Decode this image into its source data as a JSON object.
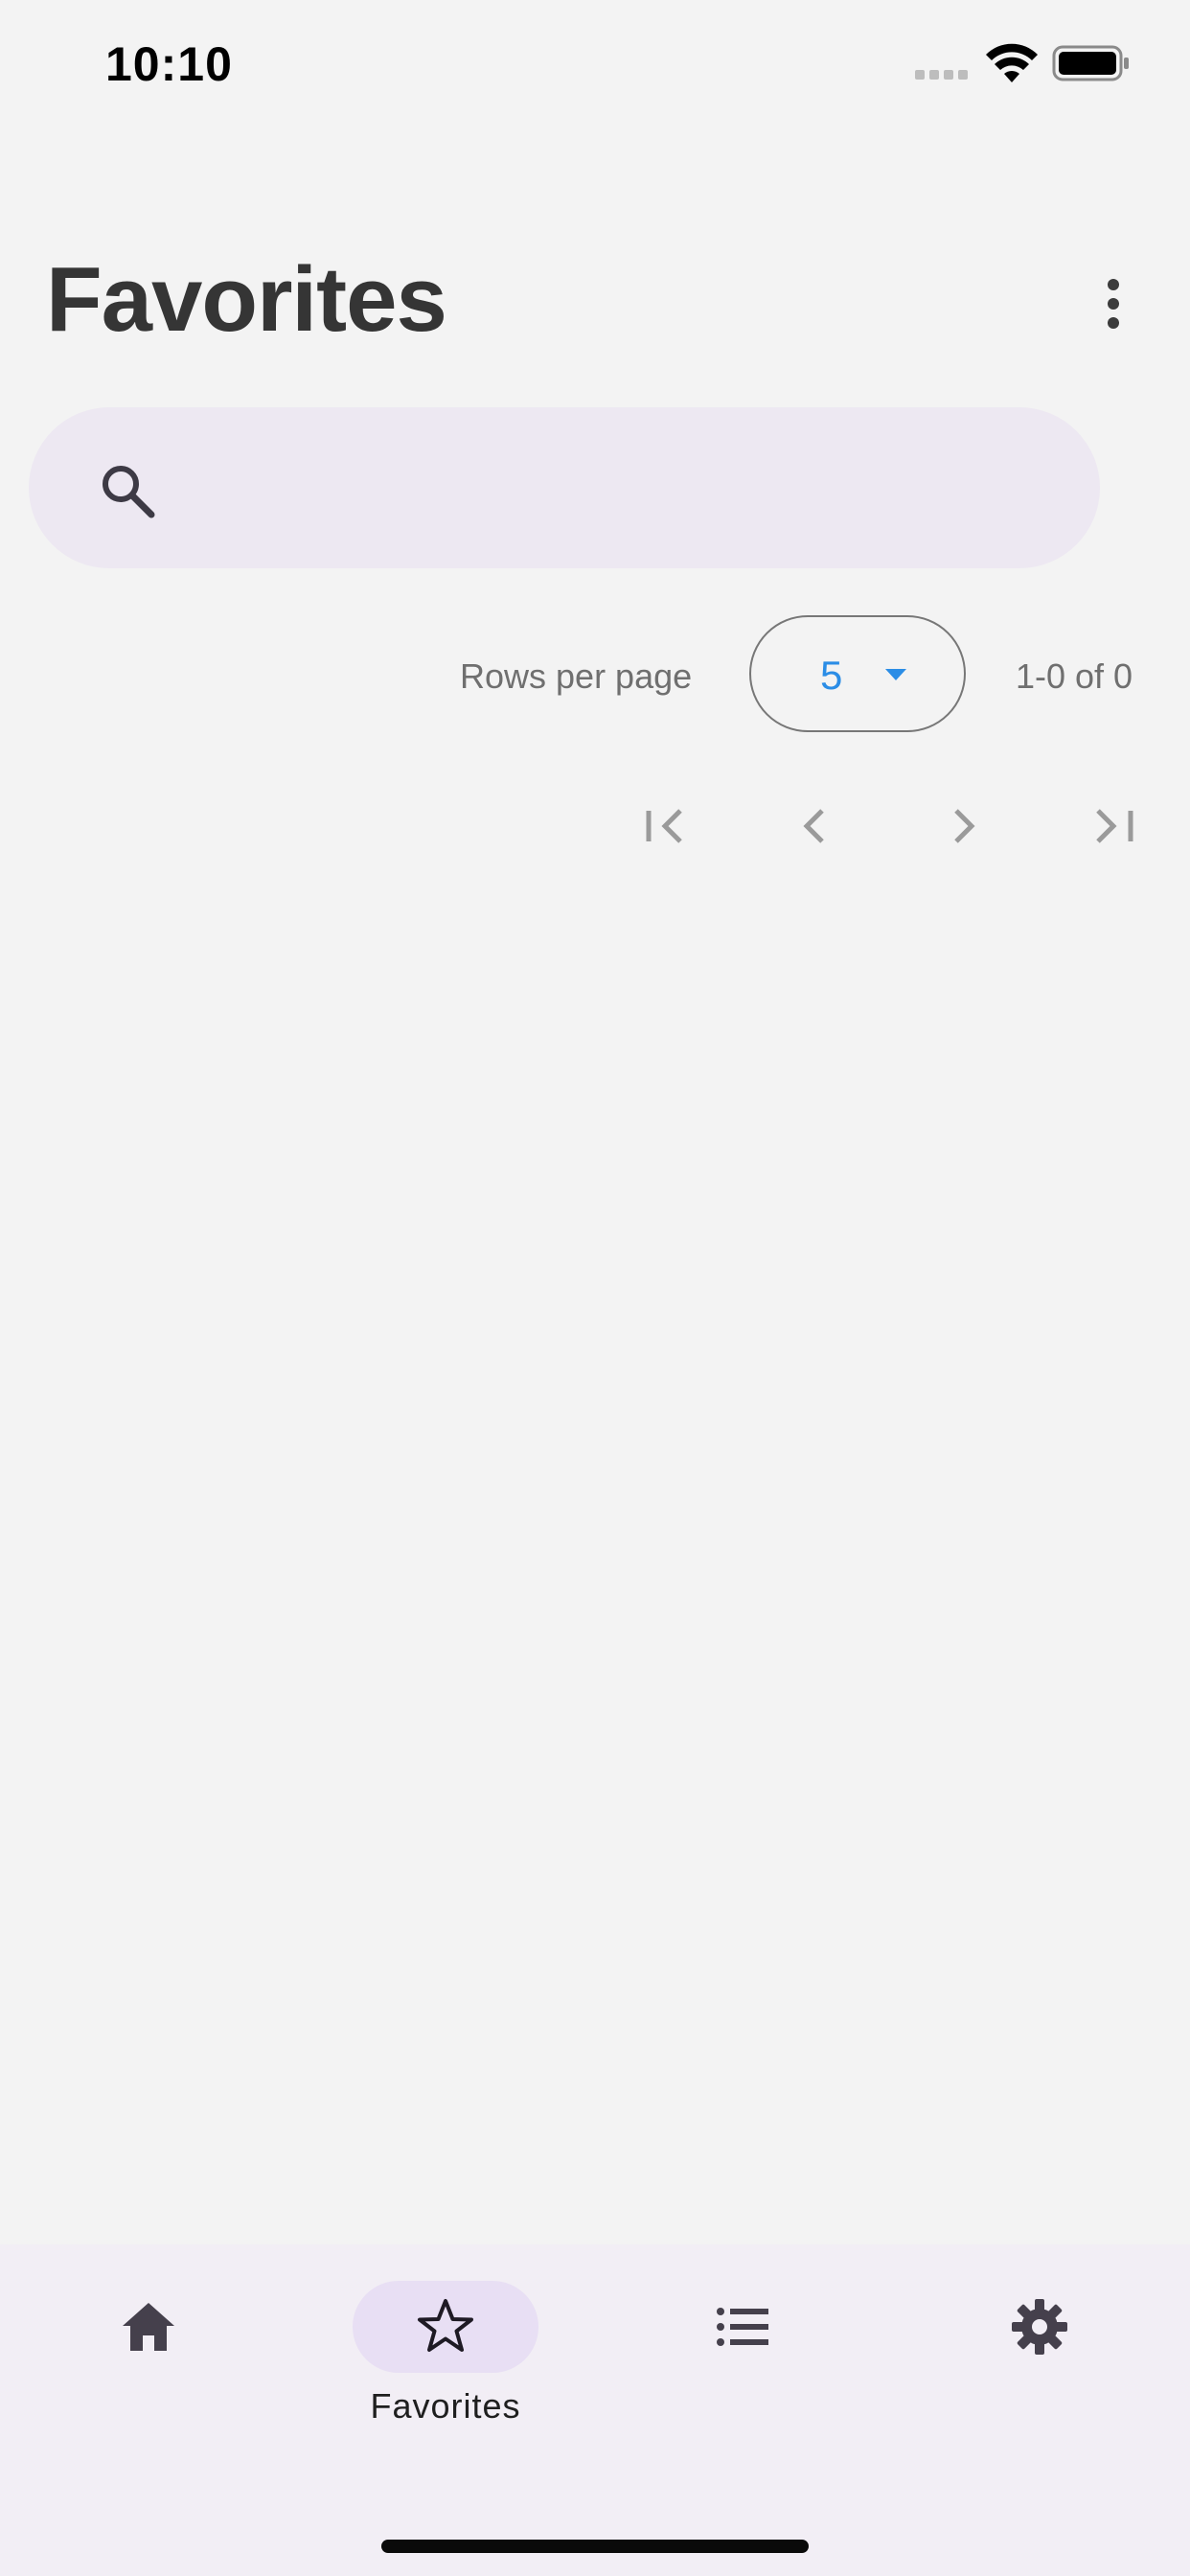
{
  "status_bar": {
    "time": "10:10"
  },
  "header": {
    "title": "Favorites"
  },
  "search": {
    "value": "",
    "placeholder": ""
  },
  "pagination": {
    "rows_per_page_label": "Rows per page",
    "rows_per_page_value": "5",
    "range_text": "1-0 of 0"
  },
  "bottom_nav": {
    "items": [
      {
        "icon": "home-icon",
        "label": ""
      },
      {
        "icon": "star-outline-icon",
        "label": "Favorites"
      },
      {
        "icon": "list-icon",
        "label": ""
      },
      {
        "icon": "gear-icon",
        "label": ""
      }
    ]
  },
  "colors": {
    "accent": "#2b8de6",
    "search_bg": "#ede8f2",
    "nav_bg": "#f2eef5",
    "nav_active_pill": "#e8dff4"
  }
}
